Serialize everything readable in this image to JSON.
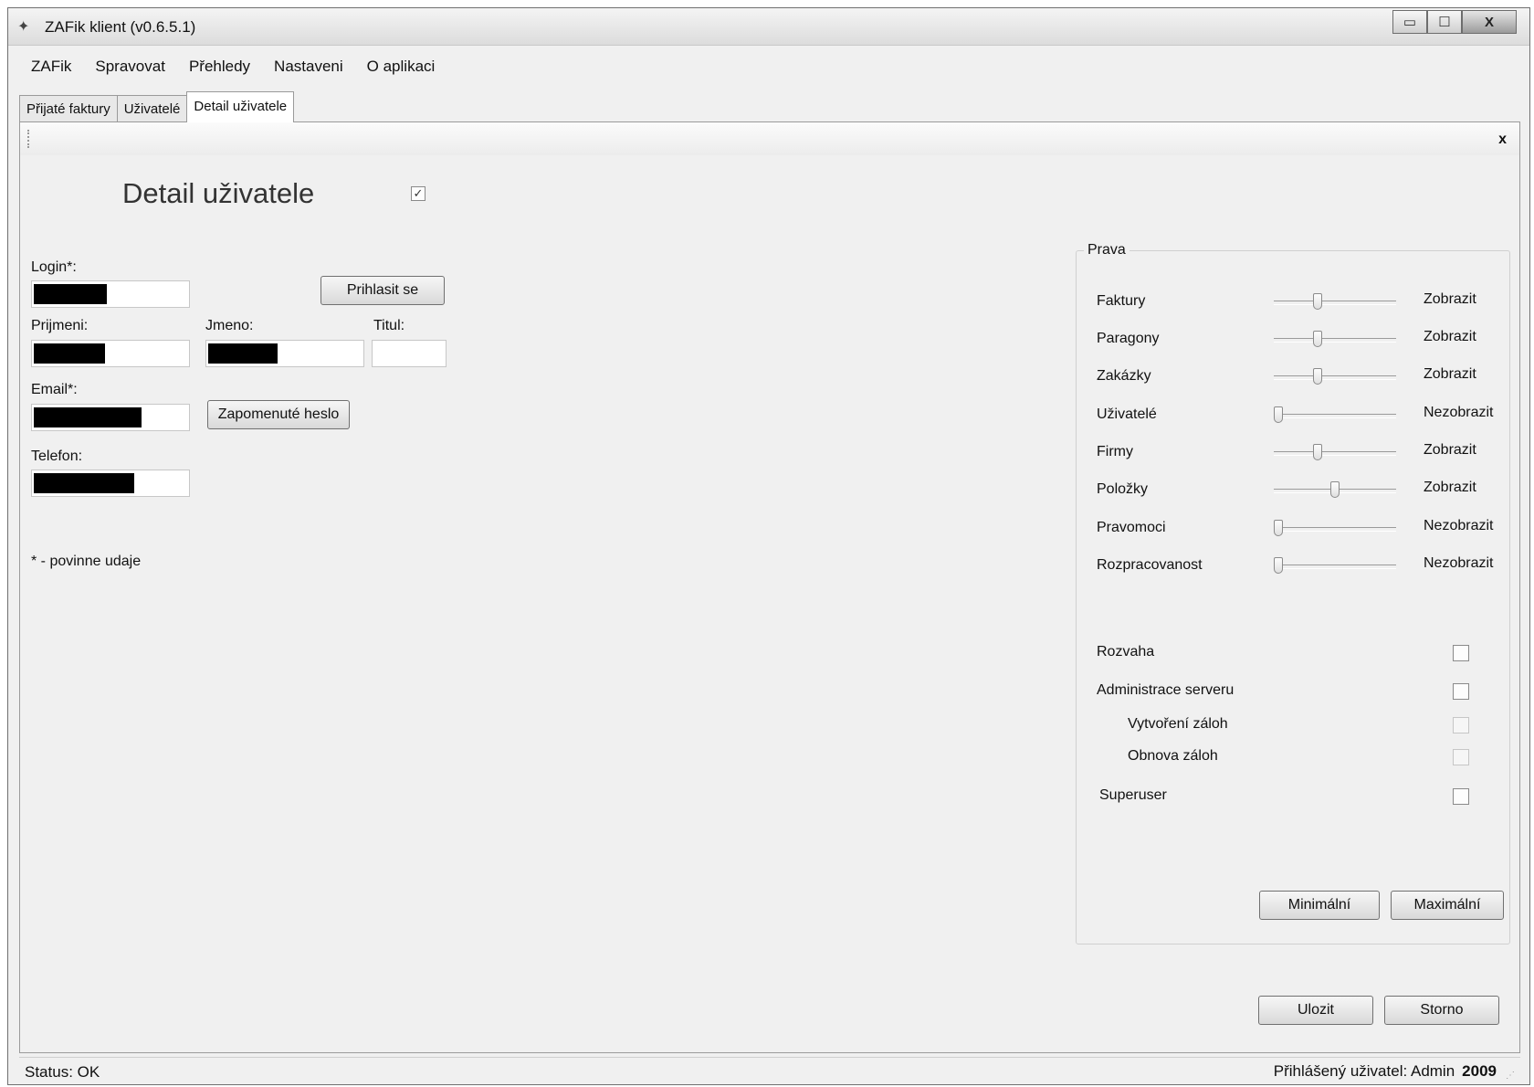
{
  "window": {
    "title": "ZAFik klient (v0.6.5.1)",
    "min": "▭",
    "max": "☐",
    "close": "X"
  },
  "menu": [
    "ZAFik",
    "Spravovat",
    "Přehledy",
    "Nastaveni",
    "O aplikaci"
  ],
  "tabs": [
    "Přijaté faktury",
    "Uživatelé",
    "Detail uživatele"
  ],
  "toolstrip": {
    "close": "x"
  },
  "form": {
    "heading": "Detail uživatele",
    "active_mark": "✓",
    "login_label": "Login*:",
    "login_button": "Prihlasit se",
    "surname_label": "Prijmeni:",
    "name_label": "Jmeno:",
    "title_label": "Titul:",
    "email_label": "Email*:",
    "forgot_button": "Zapomenuté heslo",
    "phone_label": "Telefon:",
    "required_note": "* - povinne udaje"
  },
  "rights": {
    "title": "Prava",
    "sliders": [
      {
        "label": "Faktury",
        "value": "Zobrazit",
        "level": 0.35
      },
      {
        "label": "Paragony",
        "value": "Zobrazit",
        "level": 0.35
      },
      {
        "label": "Zakázky",
        "value": "Zobrazit",
        "level": 0.35
      },
      {
        "label": "Uživatelé",
        "value": "Nezobrazit",
        "level": 0.0
      },
      {
        "label": "Firmy",
        "value": "Zobrazit",
        "level": 0.35
      },
      {
        "label": "Položky",
        "value": "Zobrazit",
        "level": 0.5
      },
      {
        "label": "Pravomoci",
        "value": "Nezobrazit",
        "level": 0.0
      },
      {
        "label": "Rozpracovanost",
        "value": "Nezobrazit",
        "level": 0.0
      }
    ],
    "checks": [
      {
        "label": "Rozvaha",
        "checked": false,
        "enabled": true
      },
      {
        "label": "Administrace serveru",
        "checked": false,
        "enabled": true
      },
      {
        "label": "Vytvoření záloh",
        "checked": false,
        "enabled": false
      },
      {
        "label": "Obnova záloh",
        "checked": false,
        "enabled": false
      },
      {
        "label": "Superuser",
        "checked": false,
        "enabled": true
      }
    ],
    "min_button": "Minimální",
    "max_button": "Maximální"
  },
  "actions": {
    "save": "Ulozit",
    "cancel": "Storno"
  },
  "status": {
    "left": "Status: OK",
    "user": "Přihlášený uživatel: Admin",
    "year": "2009"
  }
}
